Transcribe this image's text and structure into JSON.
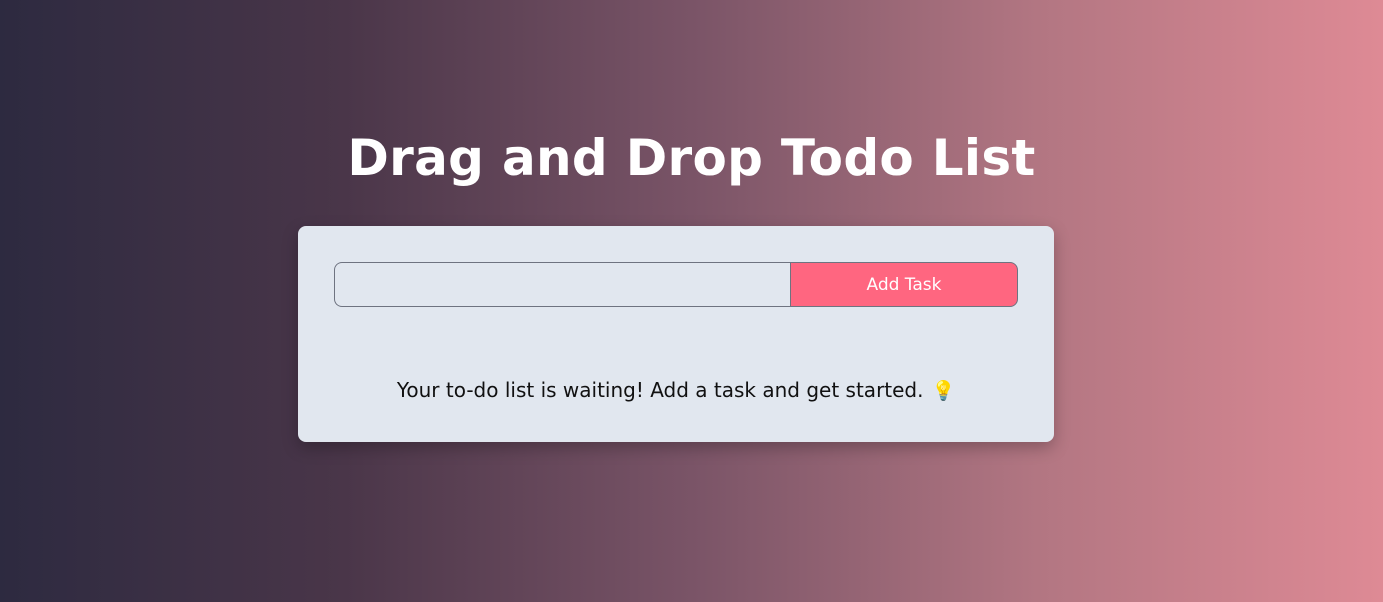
{
  "header": {
    "title": "Drag and Drop Todo List"
  },
  "form": {
    "input_value": "",
    "input_placeholder": "",
    "add_button_label": "Add Task"
  },
  "empty_state": {
    "message": "Your to-do list is waiting! Add a task and get started.",
    "icon": "lightbulb-icon",
    "icon_glyph": "💡"
  },
  "colors": {
    "button": "#ff6680",
    "card": "#e1e7ef",
    "gradient_start": "#2d2a40",
    "gradient_end": "#de8a95"
  }
}
